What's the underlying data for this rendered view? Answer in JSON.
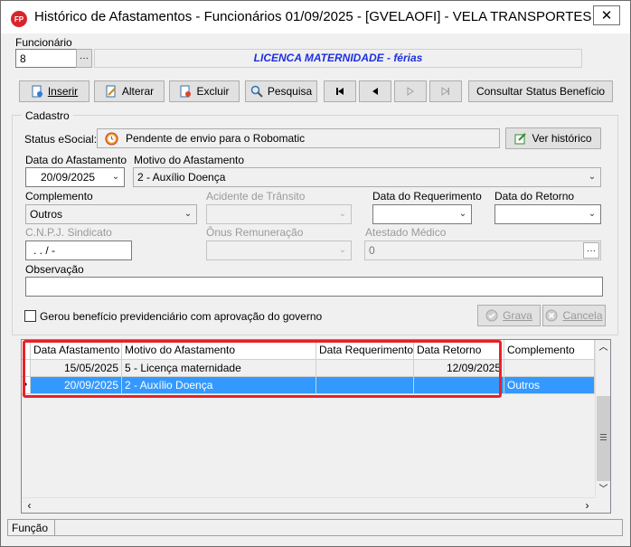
{
  "window": {
    "title": "Histórico de Afastamentos - Funcionários  01/09/2025 - [GVELAOFI] - VELA TRANSPORTES L...",
    "icon_text": "FP",
    "close_glyph": "✕"
  },
  "funcionario": {
    "label": "Funcionário",
    "value": "8",
    "lookup_glyph": "···",
    "banner": "LICENCA MATERNIDADE - férias"
  },
  "toolbar": {
    "inserir": "Inserir",
    "alterar": "Alterar",
    "excluir": "Excluir",
    "pesquisa": "Pesquisa",
    "consultar": "Consultar Status Benefício"
  },
  "cadastro": {
    "legend": "Cadastro",
    "status_label": "Status eSocial:",
    "status_value": "Pendente de envio para o Robomatic",
    "ver_historico": "Ver histórico",
    "data_afastamento_label": "Data do Afastamento",
    "data_afastamento": "20/09/2025",
    "motivo_label": "Motivo do Afastamento",
    "motivo": "2  -  Auxílio Doença",
    "complemento_label": "Complemento",
    "complemento": "Outros",
    "acidente_label": "Acidente de Trânsito",
    "data_requerimento_label": "Data do Requerimento",
    "data_retorno_label": "Data do Retorno",
    "cnpj_label": "C.N.P.J. Sindicato",
    "cnpj_value": ".  .  /   -",
    "onus_label": "Ônus Remuneração",
    "atestado_label": "Atestado Médico",
    "atestado_value": "0",
    "observacao_label": "Observação",
    "checkbox_label": "Gerou benefício previdenciário com aprovação do governo",
    "grava": "Grava",
    "cancela": "Cancela"
  },
  "grid": {
    "columns": [
      "Data Afastamento",
      "Motivo do Afastamento",
      "Data Requerimento",
      "Data Retorno",
      "Complemento"
    ],
    "rows": [
      {
        "data_afastamento": "15/05/2025",
        "motivo": "5  -  Licença maternidade",
        "data_requerimento": "",
        "data_retorno": "12/09/2025",
        "complemento": ""
      },
      {
        "data_afastamento": "20/09/2025",
        "motivo": "2  -  Auxílio Doença",
        "data_requerimento": "",
        "data_retorno": "",
        "complemento": "Outros"
      }
    ],
    "selected_row": 1,
    "highlight_color": "#e8212a",
    "selection_color": "#3399ff"
  },
  "statusbar": {
    "text": "Função"
  }
}
